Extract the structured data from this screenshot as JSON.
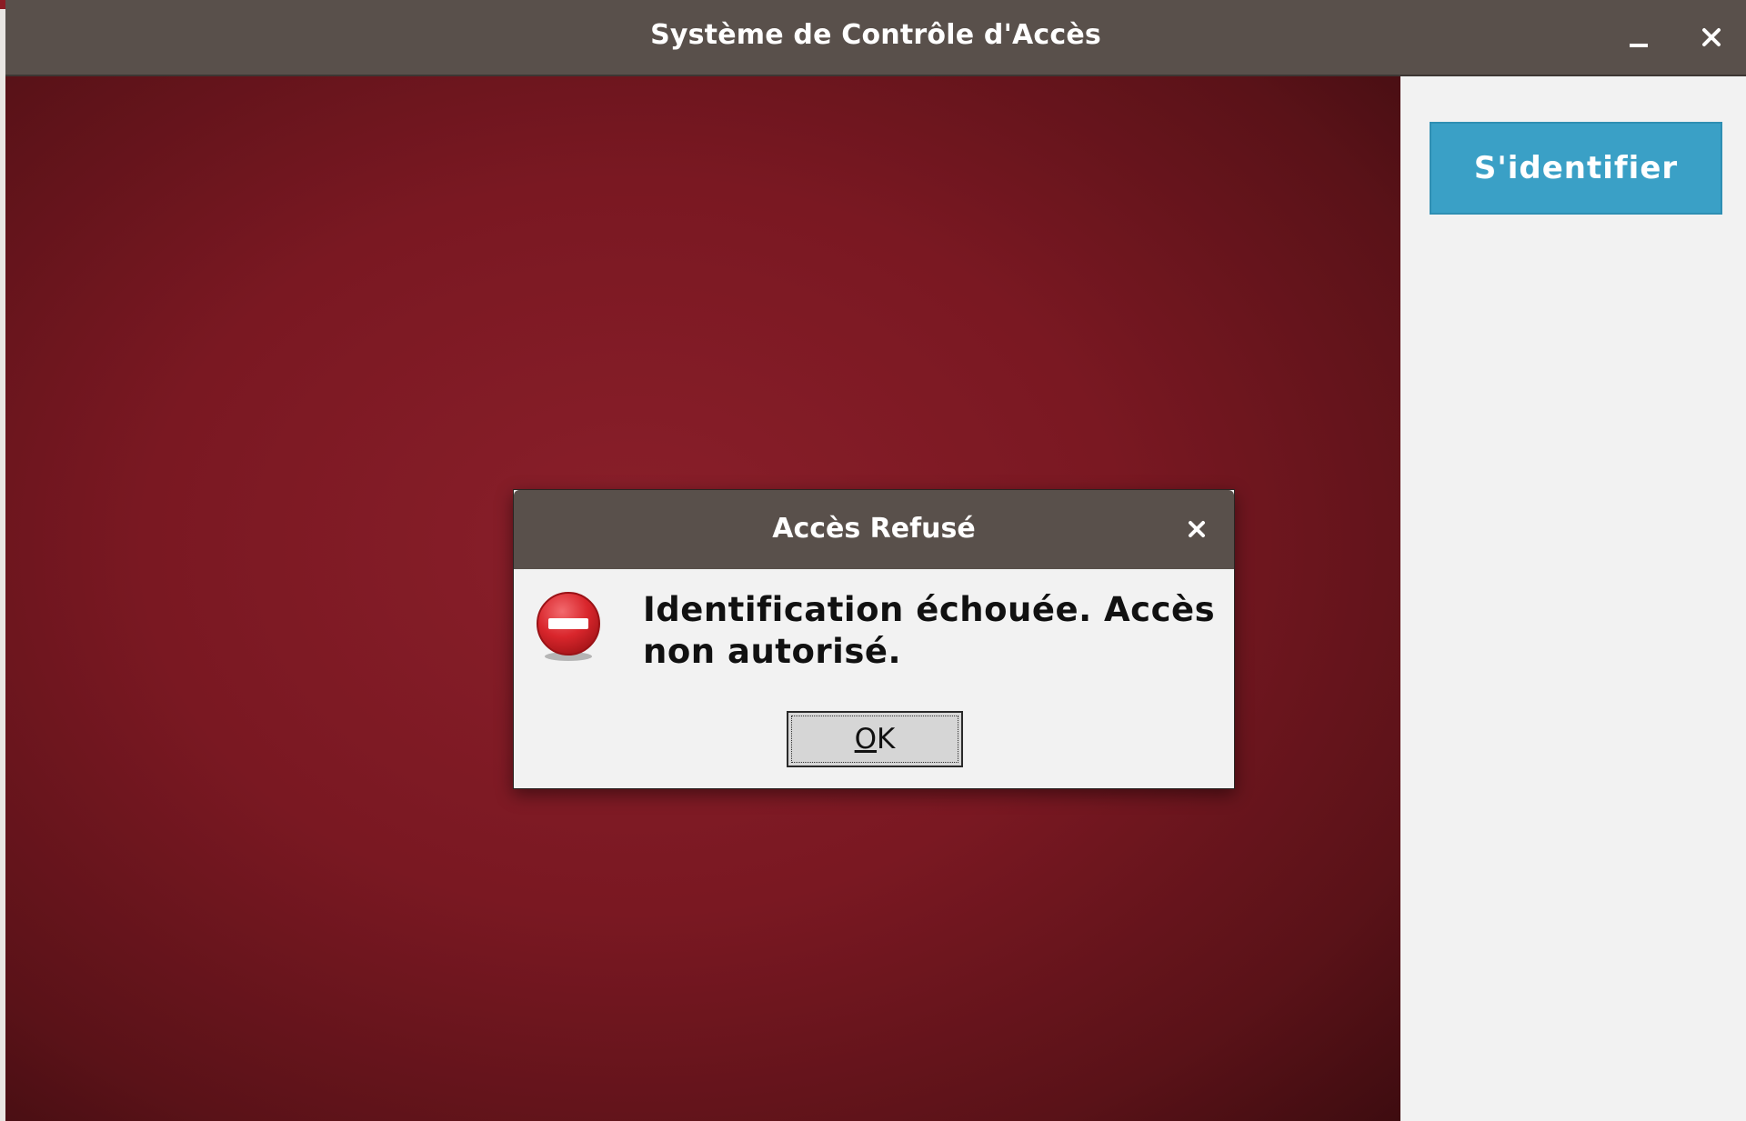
{
  "window": {
    "title": "Système de Contrôle d'Accès",
    "controls": {
      "minimize_icon": "minimize-icon",
      "close_icon": "close-icon"
    }
  },
  "sidebar": {
    "identify_label": "S'identifier"
  },
  "dialog": {
    "title": "Accès Refusé",
    "message": "Identification échouée. Accès non autorisé.",
    "ok_label": "OK",
    "icon": "error-stop-icon"
  },
  "colors": {
    "titlebar": "#59504b",
    "background_red": "#7a1822",
    "identify_button": "#3aa0c6",
    "dialog_body": "#f2f2f2",
    "error_icon": "#d9262c"
  }
}
